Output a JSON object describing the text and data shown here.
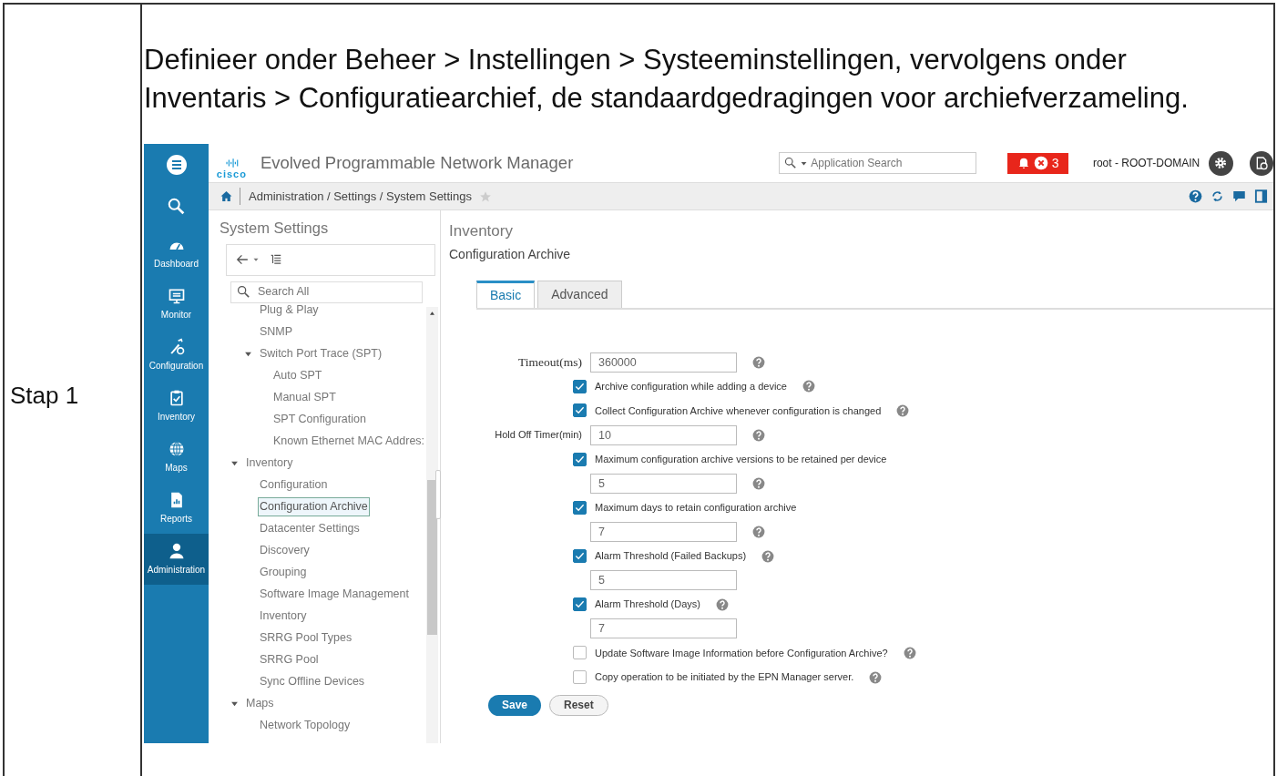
{
  "step_label": "Stap 1",
  "instruction": "Definieer onder Beheer > Instellingen > Systeeminstellingen, vervolgens onder Inventaris > Configuratiearchief, de standaardgedragingen voor archiefverzameling.",
  "app": {
    "logo_text": "cisco",
    "title": "Evolved Programmable Network Manager",
    "search": {
      "placeholder": "Application Search"
    },
    "alarm_count": "3",
    "user": "root - ROOT-DOMAIN",
    "breadcrumb": "Administration / Settings / System Settings"
  },
  "nav": [
    {
      "label": "Dashboard",
      "selected": false
    },
    {
      "label": "Monitor",
      "selected": false
    },
    {
      "label": "Configuration",
      "selected": false
    },
    {
      "label": "Inventory",
      "selected": false
    },
    {
      "label": "Maps",
      "selected": false
    },
    {
      "label": "Reports",
      "selected": false
    },
    {
      "label": "Administration",
      "selected": true
    }
  ],
  "settings_panel": {
    "title": "System Settings",
    "search": {
      "placeholder": "Search All"
    },
    "continued_items": [
      {
        "label": "Plug & Play",
        "selected": false
      },
      {
        "label": "SNMP",
        "selected": false
      },
      {
        "label": "Switch Port Trace (SPT)",
        "expanded": true,
        "selected": false,
        "children": [
          {
            "label": "Auto SPT",
            "selected": false
          },
          {
            "label": "Manual SPT",
            "selected": false
          },
          {
            "label": "SPT Configuration",
            "selected": false
          },
          {
            "label": "Known Ethernet MAC Addres:",
            "selected": false
          }
        ]
      }
    ],
    "groups": [
      {
        "label": "Inventory",
        "expanded": true,
        "selected": false,
        "children": [
          {
            "label": "Configuration",
            "selected": false
          },
          {
            "label": "Configuration Archive",
            "selected": true
          },
          {
            "label": "Datacenter Settings",
            "selected": false
          },
          {
            "label": "Discovery",
            "selected": false
          },
          {
            "label": "Grouping",
            "selected": false
          },
          {
            "label": "Software Image Management",
            "selected": false
          },
          {
            "label": "Inventory",
            "selected": false
          },
          {
            "label": "SRRG Pool Types",
            "selected": false
          },
          {
            "label": "SRRG Pool",
            "selected": false
          },
          {
            "label": "Sync Offline Devices",
            "selected": false
          }
        ]
      },
      {
        "label": "Maps",
        "expanded": true,
        "selected": false,
        "children": [
          {
            "label": "Network Topology",
            "selected": false
          }
        ]
      }
    ]
  },
  "content": {
    "section": "Inventory",
    "title": "Configuration Archive",
    "tabs": [
      {
        "label": "Basic",
        "selected": true
      },
      {
        "label": "Advanced",
        "selected": false
      }
    ],
    "form": [
      {
        "kind": "field",
        "label": "Timeout(ms)",
        "value": "360000",
        "help": true
      },
      {
        "kind": "checkbox",
        "label": "Archive configuration while adding a device",
        "checked": true,
        "help": true
      },
      {
        "kind": "checkbox",
        "label": "Collect Configuration Archive whenever configuration is changed",
        "checked": true,
        "help": true
      },
      {
        "kind": "field",
        "label": "Hold Off Timer(min)",
        "value": "10",
        "help": true
      },
      {
        "kind": "checkbox",
        "label": "Maximum configuration archive versions to be retained per device",
        "checked": true,
        "help": false
      },
      {
        "kind": "input",
        "value": "5",
        "help": true
      },
      {
        "kind": "checkbox",
        "label": "Maximum days to retain configuration archive",
        "checked": true,
        "help": false
      },
      {
        "kind": "input",
        "value": "7",
        "help": true
      },
      {
        "kind": "checkbox",
        "label": "Alarm Threshold (Failed Backups)",
        "checked": true,
        "help": true
      },
      {
        "kind": "input",
        "value": "5",
        "help": false
      },
      {
        "kind": "checkbox",
        "label": "Alarm Threshold (Days)",
        "checked": true,
        "help": true
      },
      {
        "kind": "input",
        "value": "7",
        "help": false
      },
      {
        "kind": "checkbox",
        "label": "Update Software Image Information before Configuration Archive?",
        "checked": false,
        "help": true
      },
      {
        "kind": "checkbox",
        "label": "Copy operation to be initiated by the EPN Manager server.",
        "checked": false,
        "help": true
      }
    ],
    "buttons": [
      {
        "label": "Save",
        "kind": "primary"
      },
      {
        "label": "Reset",
        "kind": "secondary"
      }
    ]
  }
}
